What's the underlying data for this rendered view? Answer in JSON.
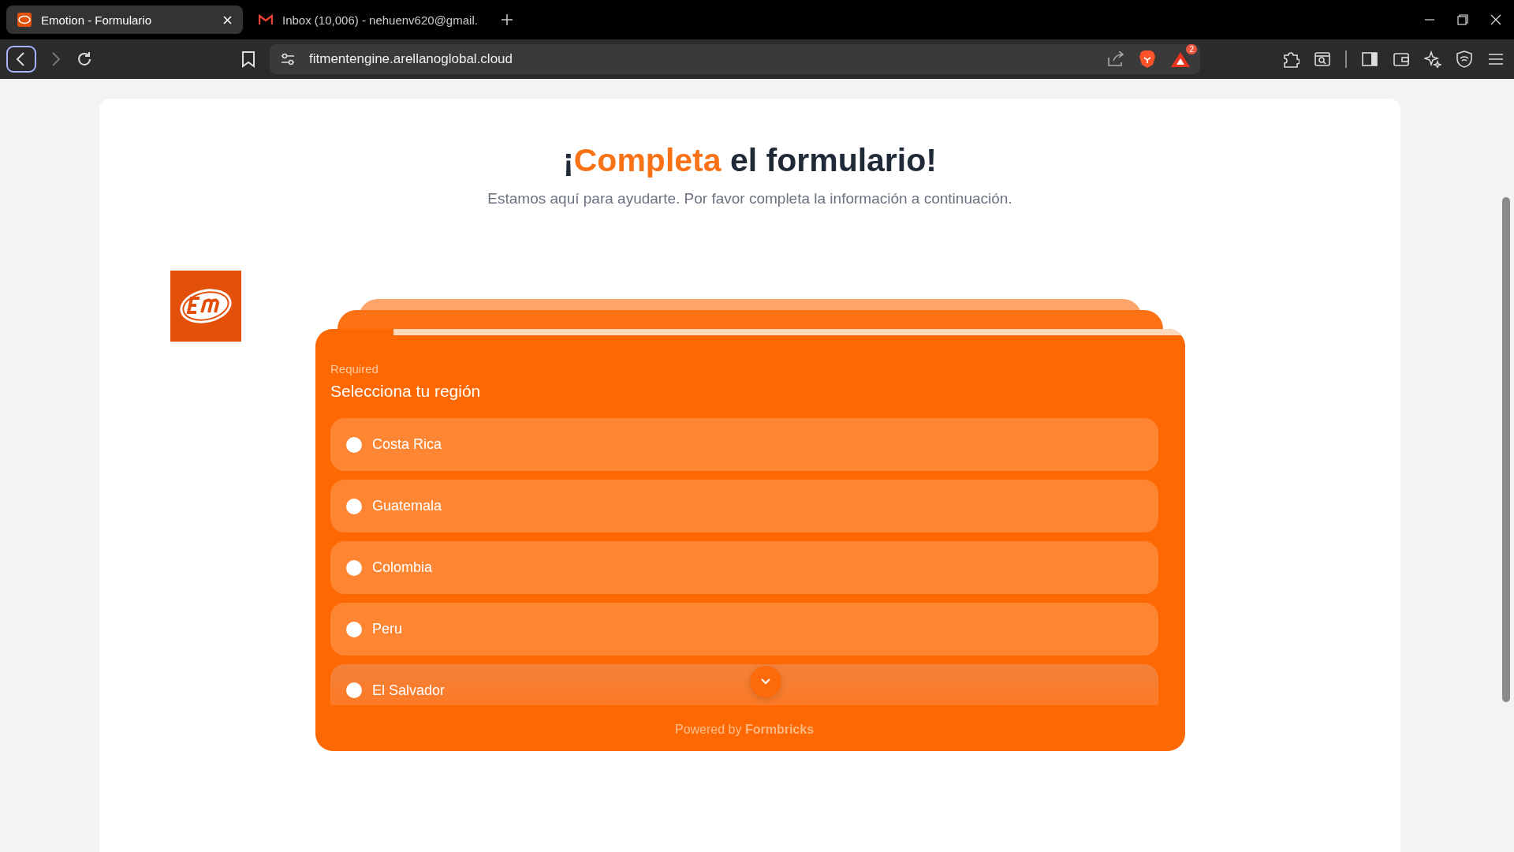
{
  "browser": {
    "tabs": [
      {
        "title": "Emotion - Formulario",
        "selected": true,
        "kind": "site"
      },
      {
        "title": "Inbox (10,006) - nehuenv620@gmail.",
        "selected": false,
        "kind": "mail"
      }
    ],
    "address": "fitmentengine.arellanoglobal.cloud",
    "rewards_badge": "2"
  },
  "page": {
    "heading": {
      "before": "¡",
      "highlight": "Completa",
      "after": " el formulario!"
    },
    "subtitle": "Estamos aquí para ayudarte. Por favor completa la información a continuación.",
    "form": {
      "progress": {
        "level": 0.09
      },
      "required_label": "Required",
      "question": "Selecciona tu región",
      "options": [
        {
          "label": "Costa Rica",
          "selected": false
        },
        {
          "label": "Guatemala",
          "selected": false
        },
        {
          "label": "Colombia",
          "selected": false
        },
        {
          "label": "Peru",
          "selected": false
        },
        {
          "label": "El Salvador",
          "selected": false
        }
      ],
      "footer": "Powered by **Formbricks**"
    }
  }
}
